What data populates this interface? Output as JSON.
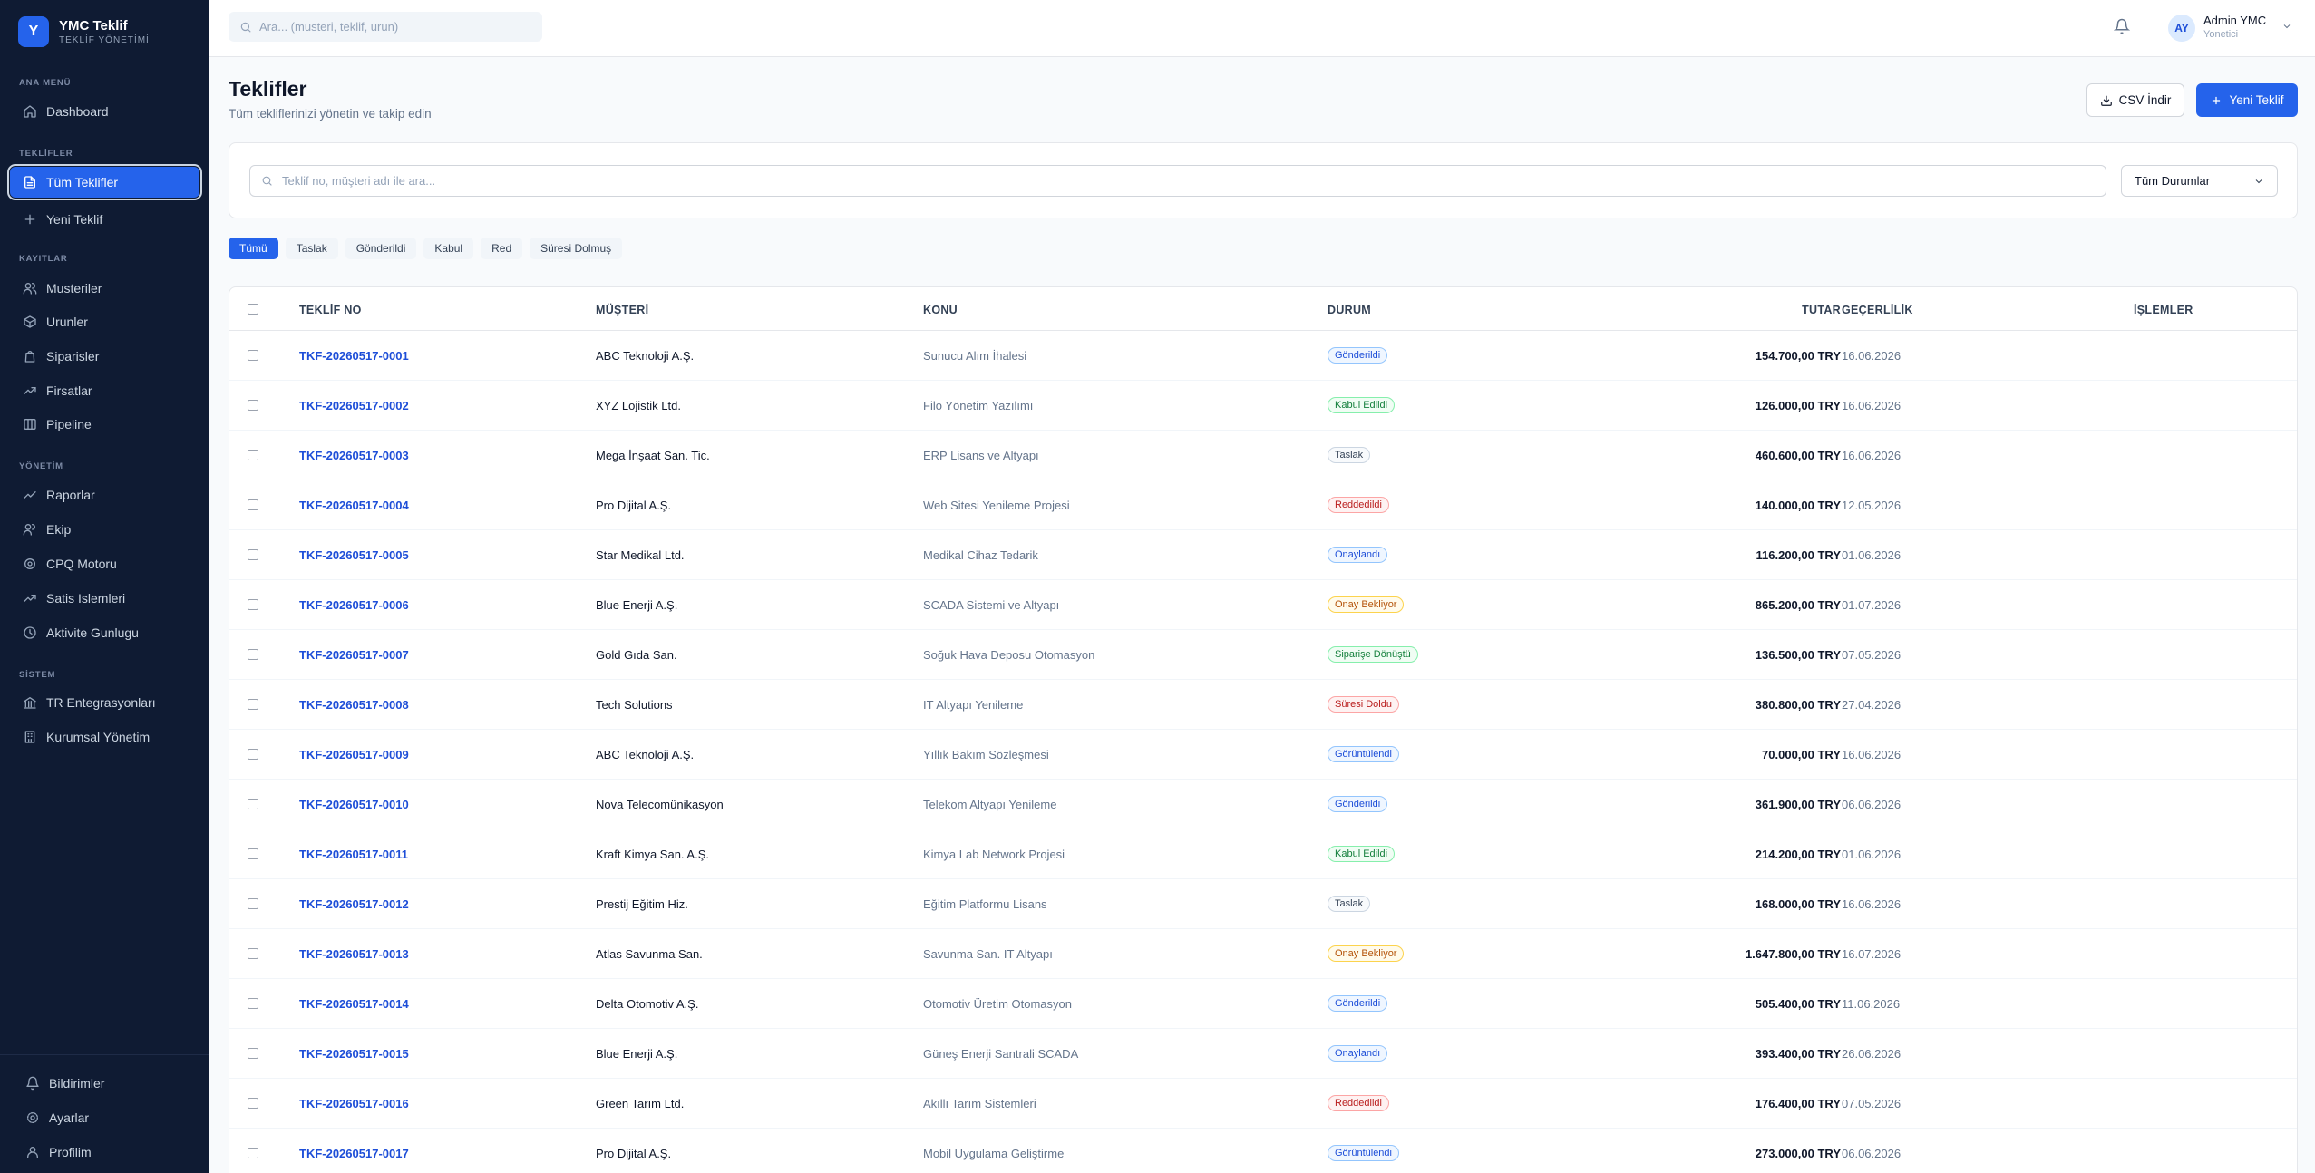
{
  "brand": {
    "logo_letter": "Y",
    "title": "YMC Teklif",
    "subtitle": "TEKLİF YÖNETİMİ"
  },
  "sidebar": {
    "sections": [
      "ANA MENÜ",
      "TEKLİFLER",
      "KAYITLAR",
      "YÖNETİM",
      "SİSTEM"
    ],
    "items": [
      {
        "label": "Dashboard",
        "icon": "home-icon"
      },
      {
        "label": "Tüm Teklifler",
        "icon": "document-icon",
        "active": true
      },
      {
        "label": "Yeni Teklif",
        "icon": "plus-icon"
      },
      {
        "label": "Musteriler",
        "icon": "users-icon"
      },
      {
        "label": "Urunler",
        "icon": "box-icon"
      },
      {
        "label": "Siparisler",
        "icon": "bag-icon"
      },
      {
        "label": "Firsatlar",
        "icon": "trend-icon"
      },
      {
        "label": "Pipeline",
        "icon": "columns-icon"
      },
      {
        "label": "Raporlar",
        "icon": "chart-icon"
      },
      {
        "label": "Ekip",
        "icon": "team-icon"
      },
      {
        "label": "CPQ Motoru",
        "icon": "cog-icon"
      },
      {
        "label": "Satis Islemleri",
        "icon": "trend-icon"
      },
      {
        "label": "Aktivite Gunlugu",
        "icon": "clock-icon"
      },
      {
        "label": "TR Entegrasyonları",
        "icon": "bank-icon"
      },
      {
        "label": "Kurumsal Yönetim",
        "icon": "building-icon"
      }
    ],
    "bottom": [
      {
        "label": "Bildirimler",
        "icon": "bell-icon"
      },
      {
        "label": "Ayarlar",
        "icon": "gear-icon"
      },
      {
        "label": "Profilim",
        "icon": "user-icon"
      }
    ]
  },
  "topbar": {
    "search_placeholder": "Ara... (musteri, teklif, urun)",
    "user_initials": "AY",
    "user_name": "Admin YMC",
    "user_role": "Yonetici"
  },
  "page": {
    "title": "Teklifler",
    "subtitle": "Tüm tekliflerinizi yönetin ve takip edin",
    "csv_label": "CSV İndir",
    "new_label": "Yeni Teklif"
  },
  "filter": {
    "search_placeholder": "Teklif no, müşteri adı ile ara...",
    "status_select": "Tüm Durumlar"
  },
  "tabs": [
    "Tümü",
    "Taslak",
    "Gönderildi",
    "Kabul",
    "Red",
    "Süresi Dolmuş"
  ],
  "table": {
    "headers": [
      "TEKLİF NO",
      "MÜŞTERİ",
      "KONU",
      "DURUM",
      "TUTAR",
      "GEÇERLİLİK",
      "İŞLEMLER"
    ],
    "rows": [
      {
        "no": "TKF-20260517-0001",
        "customer": "ABC Teknoloji A.Ş.",
        "subject": "Sunucu Alım İhalesi",
        "status": "Gönderildi",
        "tone": "blue",
        "amount": "154.700,00 TRY",
        "date": "16.06.2026"
      },
      {
        "no": "TKF-20260517-0002",
        "customer": "XYZ Lojistik Ltd.",
        "subject": "Filo Yönetim Yazılımı",
        "status": "Kabul Edildi",
        "tone": "green",
        "amount": "126.000,00 TRY",
        "date": "16.06.2026"
      },
      {
        "no": "TKF-20260517-0003",
        "customer": "Mega İnşaat San. Tic.",
        "subject": "ERP Lisans ve Altyapı",
        "status": "Taslak",
        "tone": "gray",
        "amount": "460.600,00 TRY",
        "date": "16.06.2026"
      },
      {
        "no": "TKF-20260517-0004",
        "customer": "Pro Dijital A.Ş.",
        "subject": "Web Sitesi Yenileme Projesi",
        "status": "Reddedildi",
        "tone": "red",
        "amount": "140.000,00 TRY",
        "date": "12.05.2026"
      },
      {
        "no": "TKF-20260517-0005",
        "customer": "Star Medikal Ltd.",
        "subject": "Medikal Cihaz Tedarik",
        "status": "Onaylandı",
        "tone": "blue",
        "amount": "116.200,00 TRY",
        "date": "01.06.2026"
      },
      {
        "no": "TKF-20260517-0006",
        "customer": "Blue Enerji A.Ş.",
        "subject": "SCADA Sistemi ve Altyapı",
        "status": "Onay Bekliyor",
        "tone": "orange",
        "amount": "865.200,00 TRY",
        "date": "01.07.2026"
      },
      {
        "no": "TKF-20260517-0007",
        "customer": "Gold Gıda San.",
        "subject": "Soğuk Hava Deposu Otomasyon",
        "status": "Siparişe Dönüştü",
        "tone": "green",
        "amount": "136.500,00 TRY",
        "date": "07.05.2026"
      },
      {
        "no": "TKF-20260517-0008",
        "customer": "Tech Solutions",
        "subject": "IT Altyapı Yenileme",
        "status": "Süresi Doldu",
        "tone": "red",
        "amount": "380.800,00 TRY",
        "date": "27.04.2026"
      },
      {
        "no": "TKF-20260517-0009",
        "customer": "ABC Teknoloji A.Ş.",
        "subject": "Yıllık Bakım Sözleşmesi",
        "status": "Görüntülendi",
        "tone": "blue",
        "amount": "70.000,00 TRY",
        "date": "16.06.2026"
      },
      {
        "no": "TKF-20260517-0010",
        "customer": "Nova Telecomünikasyon",
        "subject": "Telekom Altyapı Yenileme",
        "status": "Gönderildi",
        "tone": "blue",
        "amount": "361.900,00 TRY",
        "date": "06.06.2026"
      },
      {
        "no": "TKF-20260517-0011",
        "customer": "Kraft Kimya San. A.Ş.",
        "subject": "Kimya Lab Network Projesi",
        "status": "Kabul Edildi",
        "tone": "green",
        "amount": "214.200,00 TRY",
        "date": "01.06.2026"
      },
      {
        "no": "TKF-20260517-0012",
        "customer": "Prestij Eğitim Hiz.",
        "subject": "Eğitim Platformu Lisans",
        "status": "Taslak",
        "tone": "gray",
        "amount": "168.000,00 TRY",
        "date": "16.06.2026"
      },
      {
        "no": "TKF-20260517-0013",
        "customer": "Atlas Savunma San.",
        "subject": "Savunma San. IT Altyapı",
        "status": "Onay Bekliyor",
        "tone": "orange",
        "amount": "1.647.800,00 TRY",
        "date": "16.07.2026"
      },
      {
        "no": "TKF-20260517-0014",
        "customer": "Delta Otomotiv A.Ş.",
        "subject": "Otomotiv Üretim Otomasyon",
        "status": "Gönderildi",
        "tone": "blue",
        "amount": "505.400,00 TRY",
        "date": "11.06.2026"
      },
      {
        "no": "TKF-20260517-0015",
        "customer": "Blue Enerji A.Ş.",
        "subject": "Güneş Enerji Santrali SCADA",
        "status": "Onaylandı",
        "tone": "blue",
        "amount": "393.400,00 TRY",
        "date": "26.06.2026"
      },
      {
        "no": "TKF-20260517-0016",
        "customer": "Green Tarım Ltd.",
        "subject": "Akıllı Tarım Sistemleri",
        "status": "Reddedildi",
        "tone": "red",
        "amount": "176.400,00 TRY",
        "date": "07.05.2026"
      },
      {
        "no": "TKF-20260517-0017",
        "customer": "Pro Dijital A.Ş.",
        "subject": "Mobil Uygulama Geliştirme",
        "status": "Görüntülendi",
        "tone": "blue",
        "amount": "273.000,00 TRY",
        "date": "06.06.2026"
      }
    ]
  },
  "colors": {
    "accent": "#2563eb",
    "sidebar_bg": "#0f1b33",
    "tone_blue": "#1d4ed8",
    "tone_green": "#15803d",
    "tone_gray": "#334155",
    "tone_red": "#b91c1c",
    "tone_orange": "#b45309"
  }
}
